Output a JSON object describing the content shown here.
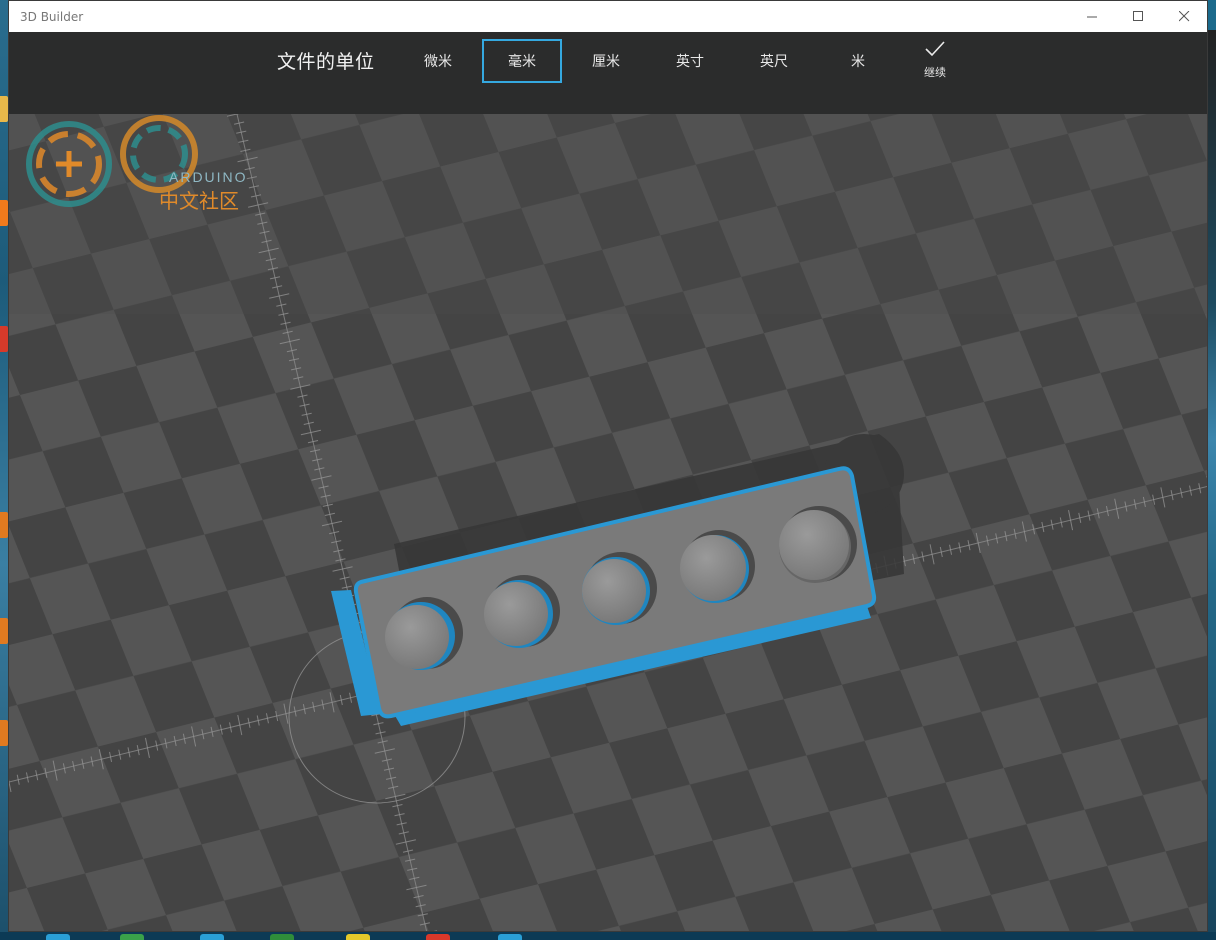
{
  "window": {
    "title": "3D Builder",
    "controls": {
      "minimize": "minimize-icon",
      "maximize": "maximize-icon",
      "close": "close-icon"
    }
  },
  "unit_bar": {
    "heading": "文件的单位",
    "options": [
      {
        "label": "微米",
        "selected": false
      },
      {
        "label": "毫米",
        "selected": true
      },
      {
        "label": "厘米",
        "selected": false
      },
      {
        "label": "英寸",
        "selected": false
      },
      {
        "label": "英尺",
        "selected": false
      },
      {
        "label": "米",
        "selected": false
      }
    ],
    "continue_label": "继续",
    "continue_icon": "checkmark-icon"
  },
  "scene": {
    "model": "rectangular plate with five round buttons",
    "knob_count": 5,
    "accent_color": "#2a98d4",
    "plate_color": "#7d7d7d"
  },
  "watermark": {
    "brand": "ARDUINO",
    "text": "中文社区"
  },
  "colors": {
    "toolbar_bg": "#2b2c2c",
    "selection_border": "#35a9e0",
    "grid_dark": "#3f3f3f",
    "grid_light": "#575757"
  }
}
